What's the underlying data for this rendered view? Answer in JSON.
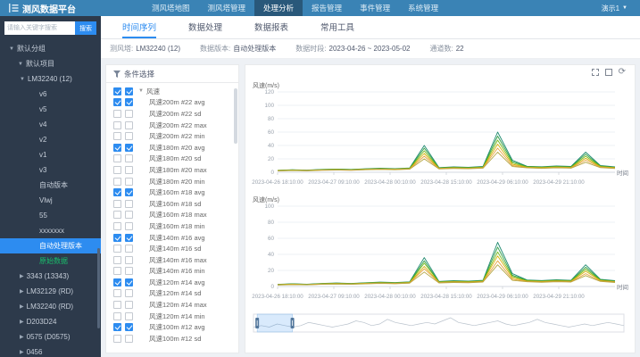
{
  "nav": {
    "brand": "测风数据平台",
    "items": [
      {
        "label": "测风塔地图",
        "active": false
      },
      {
        "label": "测风塔管理",
        "active": false
      },
      {
        "label": "处理分析",
        "active": true
      },
      {
        "label": "报告管理",
        "active": false
      },
      {
        "label": "事件管理",
        "active": false
      },
      {
        "label": "系统管理",
        "active": false
      }
    ],
    "user": "演示1"
  },
  "sidebar": {
    "search_placeholder": "请输入关键字搜索",
    "search_button": "搜索",
    "tree": [
      {
        "label": "默认分组",
        "depth": 0,
        "arrow": "down"
      },
      {
        "label": "默认项目",
        "depth": 1,
        "arrow": "down"
      },
      {
        "label": "LM32240 (12)",
        "depth": 2,
        "arrow": "down"
      },
      {
        "label": "v6",
        "depth": 3
      },
      {
        "label": "v5",
        "depth": 3
      },
      {
        "label": "v4",
        "depth": 3
      },
      {
        "label": "v2",
        "depth": 3
      },
      {
        "label": "v1",
        "depth": 3
      },
      {
        "label": "v3",
        "depth": 3
      },
      {
        "label": "自动版本",
        "depth": 3
      },
      {
        "label": "Vlwj",
        "depth": 3
      },
      {
        "label": "55",
        "depth": 3
      },
      {
        "label": "xxxxxxx",
        "depth": 3
      },
      {
        "label": "自动处理版本",
        "depth": 3,
        "selected": true
      },
      {
        "label": "原始数据",
        "depth": 3,
        "green": true
      },
      {
        "label": "3343 (13343)",
        "depth": 2,
        "arrow": "right"
      },
      {
        "label": "LM32129 (RD)",
        "depth": 2,
        "arrow": "right"
      },
      {
        "label": "LM32240 (RD)",
        "depth": 2,
        "arrow": "right"
      },
      {
        "label": "D203D24",
        "depth": 2,
        "arrow": "right"
      },
      {
        "label": "0575 (D0575)",
        "depth": 2,
        "arrow": "right"
      },
      {
        "label": "0456",
        "depth": 2,
        "arrow": "right"
      }
    ]
  },
  "tabs": [
    {
      "label": "时间序列",
      "active": true
    },
    {
      "label": "数据处理",
      "active": false
    },
    {
      "label": "数据报表",
      "active": false
    },
    {
      "label": "常用工具",
      "active": false
    }
  ],
  "info": {
    "fields": [
      {
        "label": "测风塔:",
        "value": "LM32240 (12)"
      },
      {
        "label": "数据版本:",
        "value": "自动处理版本"
      },
      {
        "label": "数据时段:",
        "value": "2023-04-26 ~ 2023-05-02"
      },
      {
        "label": "通道数:",
        "value": "22"
      }
    ]
  },
  "filter_panel": {
    "title": "条件选择",
    "channels": [
      {
        "label": "风速",
        "group": true,
        "checked": true
      },
      {
        "label": "风速200m #22 avg",
        "checked": true
      },
      {
        "label": "风速200m #22 sd",
        "checked": false
      },
      {
        "label": "风速200m #22 max",
        "checked": false
      },
      {
        "label": "风速200m #22 min",
        "checked": false
      },
      {
        "label": "风速180m #20 avg",
        "checked": true
      },
      {
        "label": "风速180m #20 sd",
        "checked": false
      },
      {
        "label": "风速180m #20 max",
        "checked": false
      },
      {
        "label": "风速180m #20 min",
        "checked": false
      },
      {
        "label": "风速160m #18 avg",
        "checked": true
      },
      {
        "label": "风速160m #18 sd",
        "checked": false
      },
      {
        "label": "风速160m #18 max",
        "checked": false
      },
      {
        "label": "风速160m #18 min",
        "checked": false
      },
      {
        "label": "风速140m #16 avg",
        "checked": true
      },
      {
        "label": "风速140m #16 sd",
        "checked": false
      },
      {
        "label": "风速140m #16 max",
        "checked": false
      },
      {
        "label": "风速140m #16 min",
        "checked": false
      },
      {
        "label": "风速120m #14 avg",
        "checked": true
      },
      {
        "label": "风速120m #14 sd",
        "checked": false
      },
      {
        "label": "风速120m #14 max",
        "checked": false
      },
      {
        "label": "风速120m #14 min",
        "checked": false
      },
      {
        "label": "风速100m #12 avg",
        "checked": true
      },
      {
        "label": "风速100m #12 sd",
        "checked": false
      }
    ]
  },
  "toolbox_icons": [
    "box-zoom",
    "restore",
    "refresh"
  ],
  "chart_data": [
    {
      "type": "line",
      "title": "风速(m/s)",
      "xlabel": "时间",
      "ylabel": "",
      "ylim": [
        0,
        120
      ],
      "yticks": [
        0,
        20,
        40,
        60,
        80,
        100,
        120
      ],
      "x_ticks": [
        "2023-04-26 18:10:00",
        "2023-04-27 09:10:00",
        "2023-04-28 00:10:00",
        "2023-04-28 15:10:00",
        "2023-04-29 06:10:00",
        "2023-04-29 21:10:00"
      ],
      "grid": true,
      "legend_position": "none",
      "series": [
        {
          "name": "风速200m #22 avg",
          "color": "#1f8a70",
          "values": [
            3.0,
            3.8,
            3.2,
            4.2,
            4.8,
            4.2,
            5.2,
            6.0,
            5.4,
            6.4,
            40.0,
            7.0,
            8.0,
            7.4,
            8.6,
            60.0,
            18.0,
            9.0,
            8.2,
            9.4,
            8.6,
            30.0,
            10.0,
            8.0
          ]
        },
        {
          "name": "风速180m #20 avg",
          "color": "#2f9e44",
          "values": [
            2.8,
            3.6,
            3.0,
            4.0,
            4.5,
            4.0,
            4.9,
            5.6,
            5.1,
            6.0,
            36.0,
            6.6,
            7.5,
            7.0,
            8.1,
            54.0,
            16.0,
            8.5,
            7.8,
            8.8,
            8.1,
            27.0,
            9.4,
            7.5
          ]
        },
        {
          "name": "风速160m #18 avg",
          "color": "#74b816",
          "values": [
            2.6,
            3.3,
            2.8,
            3.7,
            4.2,
            3.7,
            4.6,
            5.2,
            4.8,
            5.6,
            32.0,
            6.2,
            7.0,
            6.5,
            7.6,
            48.0,
            14.0,
            8.0,
            7.3,
            8.2,
            7.6,
            24.0,
            8.8,
            7.0
          ]
        },
        {
          "name": "风速140m #16 avg",
          "color": "#d4b106",
          "values": [
            2.4,
            3.1,
            2.6,
            3.5,
            3.9,
            3.5,
            4.3,
            4.9,
            4.5,
            5.3,
            28.0,
            5.8,
            6.6,
            6.1,
            7.1,
            42.0,
            12.0,
            7.5,
            6.8,
            7.7,
            7.1,
            21.0,
            8.2,
            6.6
          ]
        },
        {
          "name": "风速120m #14 avg",
          "color": "#e8a33d",
          "values": [
            2.2,
            2.8,
            2.4,
            3.2,
            3.6,
            3.2,
            4.0,
            4.5,
            4.1,
            4.9,
            24.0,
            5.4,
            6.1,
            5.6,
            6.6,
            36.0,
            10.0,
            7.0,
            6.3,
            7.1,
            6.6,
            18.0,
            7.6,
            6.1
          ]
        },
        {
          "name": "风速100m #12 avg",
          "color": "#b5a642",
          "values": [
            2.0,
            2.6,
            2.2,
            3.0,
            3.3,
            3.0,
            3.7,
            4.2,
            3.8,
            4.5,
            20.0,
            5.0,
            5.6,
            5.2,
            6.1,
            30.0,
            8.5,
            6.5,
            5.8,
            6.6,
            6.1,
            15.0,
            7.0,
            5.6
          ]
        }
      ]
    },
    {
      "type": "line",
      "title": "风速(m/s)",
      "xlabel": "时间",
      "ylabel": "",
      "ylim": [
        0,
        100
      ],
      "yticks": [
        0,
        20,
        40,
        60,
        80,
        100
      ],
      "x_ticks": [
        "2023-04-26 18:10:00",
        "2023-04-27 09:10:00",
        "2023-04-28 00:10:00",
        "2023-04-28 15:10:00",
        "2023-04-29 06:10:00",
        "2023-04-29 21:10:00"
      ],
      "grid": true,
      "legend_position": "none",
      "series": [
        {
          "name": "风速200m #22 avg",
          "color": "#1f8a70",
          "values": [
            2.7,
            3.4,
            2.9,
            3.8,
            4.3,
            3.8,
            4.7,
            5.4,
            4.9,
            5.8,
            36.0,
            6.3,
            7.2,
            6.7,
            7.7,
            55.0,
            16.0,
            8.1,
            7.4,
            8.5,
            7.7,
            27.0,
            9.0,
            7.2
          ]
        },
        {
          "name": "风速180m #20 avg",
          "color": "#2f9e44",
          "values": [
            2.5,
            3.2,
            2.7,
            3.6,
            4.1,
            3.6,
            4.4,
            5.0,
            4.6,
            5.4,
            32.0,
            5.9,
            6.8,
            6.3,
            7.3,
            49.0,
            14.0,
            7.7,
            7.0,
            7.9,
            7.3,
            24.0,
            8.5,
            6.8
          ]
        },
        {
          "name": "风速160m #18 avg",
          "color": "#74b816",
          "values": [
            2.3,
            3.0,
            2.5,
            3.3,
            3.8,
            3.3,
            4.1,
            4.7,
            4.3,
            5.0,
            29.0,
            5.6,
            6.3,
            5.9,
            6.8,
            43.0,
            12.6,
            7.2,
            6.6,
            7.4,
            6.8,
            21.6,
            7.9,
            6.3
          ]
        },
        {
          "name": "风速140m #16 avg",
          "color": "#d4b106",
          "values": [
            2.2,
            2.8,
            2.3,
            3.2,
            3.5,
            3.2,
            3.9,
            4.4,
            4.1,
            4.8,
            25.0,
            5.2,
            5.9,
            5.5,
            6.4,
            38.0,
            10.8,
            6.8,
            6.1,
            6.9,
            6.4,
            19.0,
            7.4,
            5.9
          ]
        },
        {
          "name": "风速120m #14 avg",
          "color": "#e8a33d",
          "values": [
            2.0,
            2.5,
            2.2,
            2.9,
            3.2,
            2.9,
            3.6,
            4.1,
            3.7,
            4.4,
            22.0,
            4.9,
            5.5,
            5.0,
            5.9,
            32.0,
            9.0,
            6.3,
            5.7,
            6.4,
            5.9,
            16.0,
            6.8,
            5.5
          ]
        },
        {
          "name": "风速100m #12 avg",
          "color": "#b5a642",
          "values": [
            1.8,
            2.3,
            2.0,
            2.7,
            3.0,
            2.7,
            3.3,
            3.8,
            3.4,
            4.1,
            18.0,
            4.5,
            5.0,
            4.7,
            5.5,
            27.0,
            7.7,
            5.9,
            5.2,
            5.9,
            5.5,
            13.5,
            6.3,
            5.0
          ]
        }
      ]
    }
  ],
  "brush": {
    "window_start": 0.01,
    "window_end": 0.105,
    "shadow": [
      2,
      3,
      2,
      4,
      3,
      2,
      3,
      5,
      4,
      3,
      2,
      3,
      4,
      6,
      5,
      3,
      4,
      7,
      5,
      4,
      3,
      4,
      5,
      4,
      6,
      8,
      5,
      4,
      3,
      4,
      5,
      6,
      4,
      3,
      4,
      5,
      7,
      5,
      4,
      3,
      2,
      3,
      4,
      3,
      4,
      5,
      4,
      3
    ]
  },
  "colors": {
    "accent": "#2d8cf0",
    "nav_bg": "#3a83b5",
    "nav_active_bg": "#29587a",
    "sidebar_bg": "#2d3a4b",
    "green_text": "#19be6b"
  }
}
